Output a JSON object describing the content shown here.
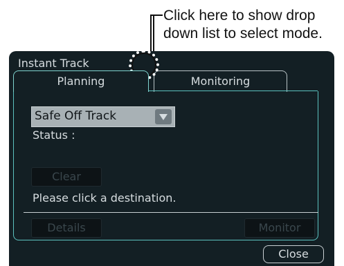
{
  "callout": {
    "line1": "Click here to show drop",
    "line2": "down list to select mode."
  },
  "window": {
    "title": "Instant Track",
    "tabs": [
      {
        "label": "Planning",
        "active": true
      },
      {
        "label": "Monitoring",
        "active": false
      }
    ],
    "mode_select": {
      "value": "Safe Off Track"
    },
    "status_label": "Status :",
    "clear_label": "Clear",
    "message": "Please click a destination.",
    "details_label": "Details",
    "monitor_label": "Monitor",
    "close_label": "Close"
  }
}
